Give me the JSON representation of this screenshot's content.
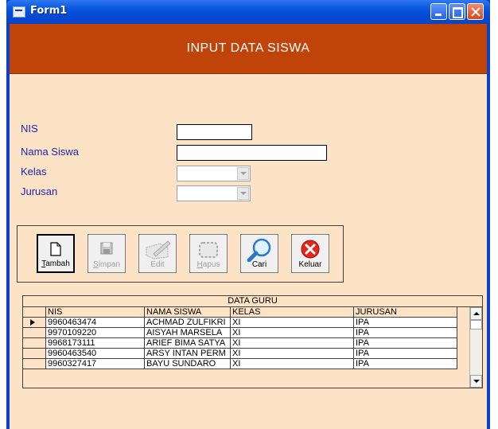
{
  "window": {
    "title": "Form1"
  },
  "banner": {
    "title": "INPUT DATA SISWA"
  },
  "form": {
    "labels": [
      "NIS",
      "Nama Siswa",
      "Kelas",
      "Jurusan"
    ],
    "nis_value": "",
    "nama_value": "",
    "kelas_value": "",
    "jurusan_value": ""
  },
  "toolbar": {
    "buttons": [
      {
        "label": "Tambah",
        "icon": "new-document-icon",
        "enabled": true
      },
      {
        "label": "Simpan",
        "icon": "floppy-disk-icon",
        "enabled": false
      },
      {
        "label": "Edit",
        "icon": "pencil-icon",
        "enabled": false
      },
      {
        "label": "Hapus",
        "icon": "delete-frame-icon",
        "enabled": false
      },
      {
        "label": "Cari",
        "icon": "magnifier-icon",
        "enabled": true
      },
      {
        "label": "Keluar",
        "icon": "red-x-icon",
        "enabled": true
      }
    ]
  },
  "grid": {
    "caption": "DATA GURU",
    "columns": [
      "NIS",
      "NAMA SISWA",
      "KELAS",
      "JURUSAN"
    ],
    "rows": [
      [
        "9960463474",
        "ACHMAD ZULFIKRI",
        "XI",
        "IPA"
      ],
      [
        "9970109220",
        "AISYAH MARSELA",
        "XI",
        "IPA"
      ],
      [
        "9968173111",
        "ARIEF BIMA SATYA",
        "XI",
        "IPA"
      ],
      [
        "9960463540",
        "ARSY INTAN PERM",
        "XI",
        "IPA"
      ],
      [
        "9960327417",
        "BAYU SUNDARO",
        "XI",
        "IPA"
      ]
    ]
  },
  "colors": {
    "banner": "#c0430a",
    "form_bg": "#fde3c5",
    "label_text": "#2222aa"
  }
}
